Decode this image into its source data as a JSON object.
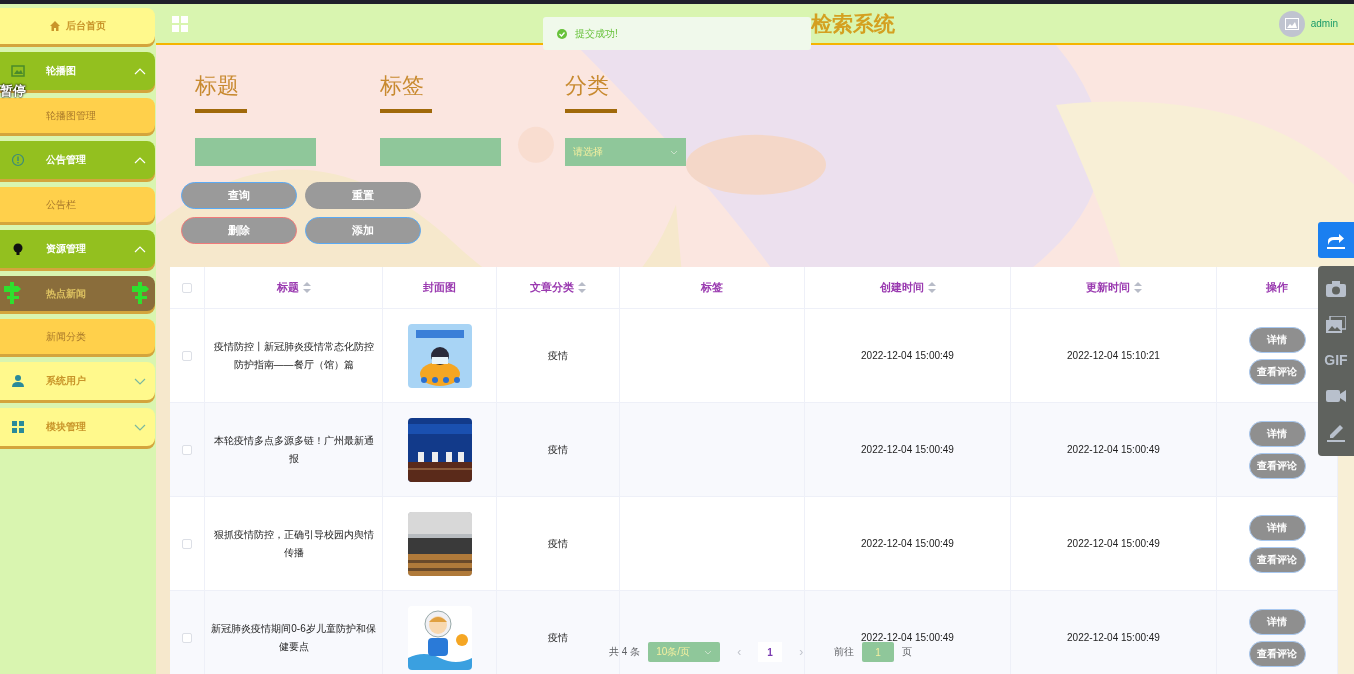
{
  "overlay_label": "暂停",
  "sidebar": {
    "home": {
      "label": "后台首页"
    },
    "menus": [
      {
        "label": "轮播图",
        "expanded": true,
        "children": [
          {
            "label": "轮播图管理",
            "selected": false
          }
        ]
      },
      {
        "label": "公告管理",
        "expanded": true,
        "children": [
          {
            "label": "公告栏",
            "selected": false
          }
        ]
      },
      {
        "label": "资源管理",
        "expanded": true,
        "children": [
          {
            "label": "热点新闻",
            "selected": true
          },
          {
            "label": "新闻分类",
            "selected": false
          }
        ]
      },
      {
        "label": "系统用户",
        "expanded": false
      },
      {
        "label": "模块管理",
        "expanded": false
      }
    ]
  },
  "header": {
    "title": "检索系统",
    "user": "admin"
  },
  "toast": {
    "message": "提交成功!"
  },
  "search": {
    "fields": [
      {
        "label": "标题",
        "kind": "input"
      },
      {
        "label": "标签",
        "kind": "input"
      },
      {
        "label": "分类",
        "kind": "select",
        "placeholder": "请选择"
      }
    ],
    "buttons": [
      {
        "label": "查询",
        "kind": "search"
      },
      {
        "label": "重置",
        "kind": "reset"
      },
      {
        "label": "删除",
        "kind": "danger"
      },
      {
        "label": "添加",
        "kind": "add"
      }
    ]
  },
  "table": {
    "select_all": false,
    "columns": [
      {
        "label": "标题",
        "sortable": true
      },
      {
        "label": "封面图",
        "sortable": false
      },
      {
        "label": "文章分类",
        "sortable": true
      },
      {
        "label": "标签",
        "sortable": false
      },
      {
        "label": "创建时间",
        "sortable": true
      },
      {
        "label": "更新时间",
        "sortable": true
      },
      {
        "label": "操作",
        "sortable": false
      }
    ],
    "rows": [
      {
        "checked": false,
        "title": "疫情防控丨新冠肺炎疫情常态化防控防护指南——餐厅（馆）篇",
        "category": "疫情",
        "created": "2022-12-04 15:00:49",
        "updated": "2022-12-04 15:10:21",
        "actions": [
          "详情",
          "查看评论"
        ]
      },
      {
        "checked": false,
        "title": "本轮疫情多点多源多链！广州最新通报",
        "category": "疫情",
        "created": "2022-12-04 15:00:49",
        "updated": "2022-12-04 15:00:49",
        "actions": [
          "详情",
          "查看评论"
        ]
      },
      {
        "checked": false,
        "title": "狠抓疫情防控，正确引导校园内舆情传播",
        "category": "疫情",
        "created": "2022-12-04 15:00:49",
        "updated": "2022-12-04 15:00:49",
        "actions": [
          "详情",
          "查看评论"
        ]
      },
      {
        "checked": false,
        "title": "新冠肺炎疫情期间0-6岁儿童防护和保健要点",
        "category": "疫情",
        "created": "2022-12-04 15:00:49",
        "updated": "2022-12-04 15:00:49",
        "actions": [
          "详情",
          "查看评论"
        ]
      }
    ]
  },
  "pager": {
    "total": "共 4 条",
    "page_size": "10条/页",
    "prev": "‹",
    "pages": [
      {
        "label": "1",
        "selected": true
      }
    ],
    "next": "›",
    "goto_label": "前往",
    "goto_value": "1",
    "page_suffix": "页"
  },
  "side_tools": {
    "gif_label": "GIF"
  }
}
